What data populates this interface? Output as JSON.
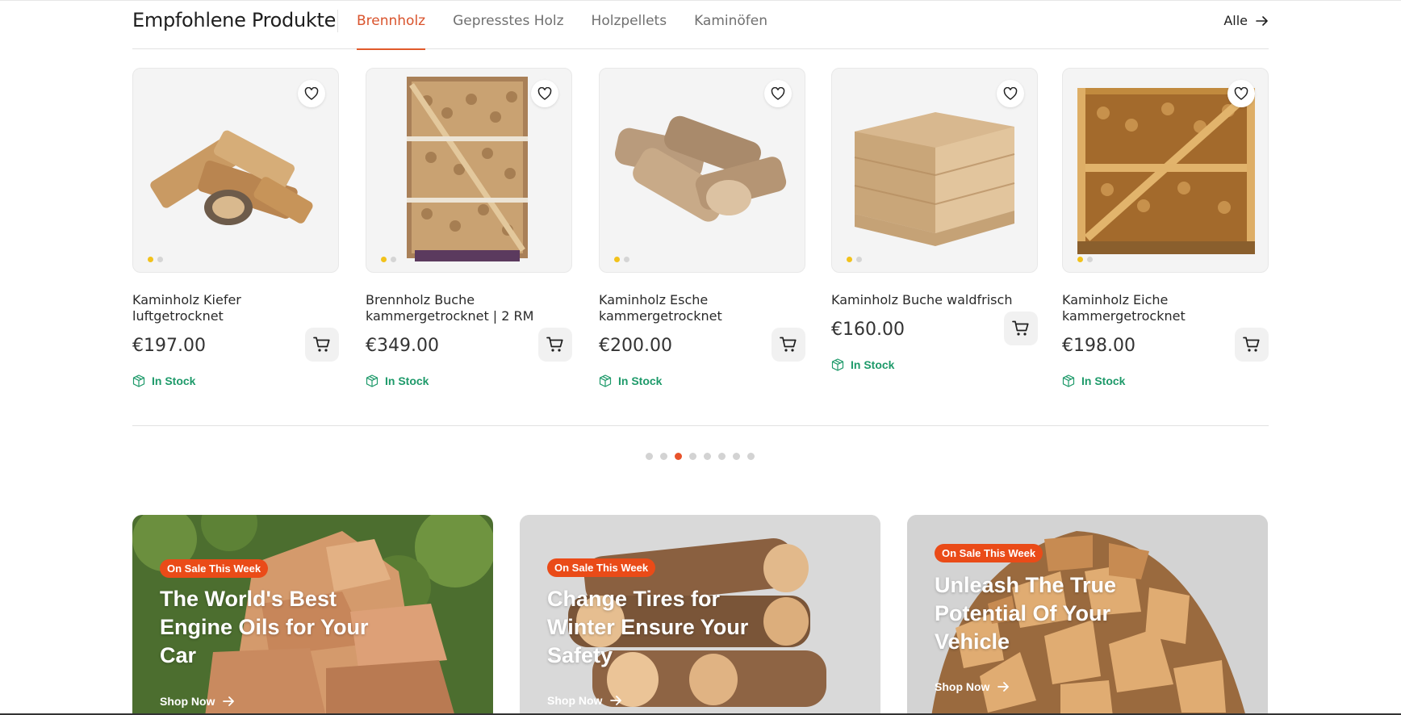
{
  "header": {
    "title": "Empfohlene Produkte",
    "tabs": [
      {
        "label": "Brennholz",
        "active": true
      },
      {
        "label": "Gepresstes Holz",
        "active": false
      },
      {
        "label": "Holzpellets",
        "active": false
      },
      {
        "label": "Kaminöfen",
        "active": false
      }
    ],
    "all_label": "Alle"
  },
  "products": [
    {
      "name": "Kaminholz Kiefer luftgetrocknet",
      "price": "€197.00",
      "stock": "In Stock",
      "icon": "firewood-logs"
    },
    {
      "name": "Brennholz Buche kammergetrocknet | 2 RM",
      "price": "€349.00",
      "stock": "In Stock",
      "icon": "wood-crate-tall"
    },
    {
      "name": "Kaminholz Esche kammergetrocknet",
      "price": "€200.00",
      "stock": "In Stock",
      "icon": "firewood-logs"
    },
    {
      "name": "Kaminholz Buche waldfrisch",
      "price": "€160.00",
      "stock": "In Stock",
      "icon": "wood-pallet"
    },
    {
      "name": "Kaminholz Eiche kammergetrocknet",
      "price": "€198.00",
      "stock": "In Stock",
      "icon": "wood-crate"
    }
  ],
  "pagination": {
    "count": 8,
    "active_index": 2
  },
  "promos": [
    {
      "badge": "On Sale This Week",
      "title": "The World's Best Engine Oils for Your Car",
      "cta": "Shop Now"
    },
    {
      "badge": "On Sale This Week",
      "title": "Change Tires for Winter Ensure Your Safety",
      "cta": "Shop Now"
    },
    {
      "badge": "On Sale This Week",
      "title": "Unleash The True Potential Of Your Vehicle",
      "cta": "Shop Now"
    }
  ],
  "colors": {
    "accent": "#e05a2b",
    "badge": "#ea4b18",
    "stock": "#1e9a6a",
    "image_dot_active": "#f2c21b"
  }
}
